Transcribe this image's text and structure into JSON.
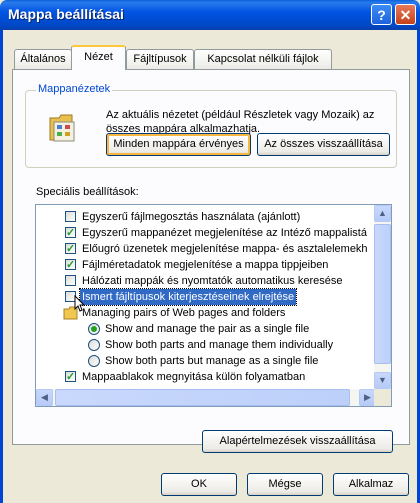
{
  "window": {
    "title": "Mappa beállításai",
    "help_label": "?",
    "close_label": "✕"
  },
  "tabs": [
    "Általános",
    "Nézet",
    "Fájltípusok",
    "Kapcsolat nélküli fájlok"
  ],
  "folder_views": {
    "group_label": "Mappanézetek",
    "description": "Az aktuális nézetet (például Részletek vagy Mozaik) az összes mappára alkalmazhatja.",
    "apply_all_button": "Minden mappára érvényes",
    "reset_all_button": "Az összes visszaállítása"
  },
  "advanced": {
    "label": "Speciális beállítások:",
    "items": [
      {
        "type": "checkbox",
        "checked": false,
        "label": "Egyszerű fájlmegosztás használata (ajánlott)"
      },
      {
        "type": "checkbox",
        "checked": true,
        "label": "Egyszerű mappanézet megjelenítése az Intéző mappalistá"
      },
      {
        "type": "checkbox",
        "checked": true,
        "label": "Előugró üzenetek megjelenítése mappa- és asztalelemekh"
      },
      {
        "type": "checkbox",
        "checked": true,
        "label": "Fájlméretadatok megjelenítése a mappa tippjeiben"
      },
      {
        "type": "checkbox",
        "checked": false,
        "label": "Hálózati mappák és nyomtatók automatikus keresése"
      },
      {
        "type": "checkbox",
        "checked": false,
        "label": "Ismert fájltípusok kiterjesztéseinek elrejtése",
        "selected": true
      },
      {
        "type": "folder",
        "label": "Managing pairs of Web pages and folders"
      },
      {
        "type": "radio",
        "checked": true,
        "label": "Show and manage the pair as a single file"
      },
      {
        "type": "radio",
        "checked": false,
        "label": "Show both parts and manage them individually"
      },
      {
        "type": "radio",
        "checked": false,
        "label": "Show both parts but manage as a single file"
      },
      {
        "type": "checkbox",
        "checked": true,
        "label": "Mappaablakok megnyitása külön folyamatban"
      }
    ]
  },
  "restore_defaults_button": "Alapértelmezések visszaállítása",
  "buttons": {
    "ok": "OK",
    "cancel": "Mégse",
    "apply": "Alkalmaz"
  }
}
